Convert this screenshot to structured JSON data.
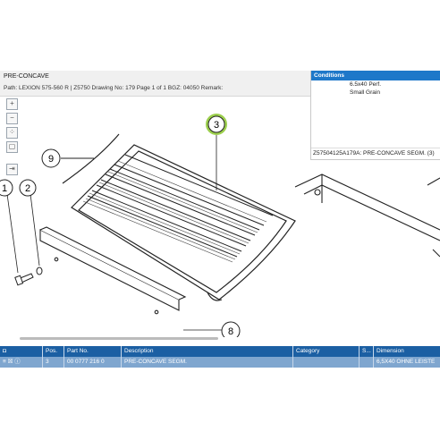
{
  "header": {
    "title": "PRE-CONCAVE",
    "path": "Path: LEXION 575-560 R | Z5750   Drawing No: 179   Page 1 of 1   BGZ: 04050   Remark:"
  },
  "conditions": {
    "title": "Conditions",
    "lines": [
      "6.5x40 Perf.",
      "Small Grain"
    ],
    "footer": "Z57504125A179A: PRE-CONCAVE SEGM. (3)"
  },
  "toolbar": {
    "icons": [
      "zoom-in-icon",
      "zoom-out-icon",
      "fit-icon",
      "page-icon",
      "export-icon"
    ],
    "glyphs": [
      "+",
      "−",
      "⁘",
      "▢",
      "⇥"
    ]
  },
  "callouts": {
    "main": "3",
    "a": "9",
    "b": "1",
    "c": "2",
    "d": "8"
  },
  "colors": {
    "callout_highlight": "#9ccf4d",
    "table_header": "#1b5fa3",
    "table_row": "#7fa6cf"
  },
  "table": {
    "columns": [
      "Pos.",
      "Part No.",
      "Description",
      "Category",
      "S...",
      "Dimension"
    ],
    "row": [
      "3",
      "00 0777 216 0",
      "PRE-CONCAVE SEGM.",
      "",
      "",
      "6,5X40 OHNE LEISTE"
    ]
  }
}
